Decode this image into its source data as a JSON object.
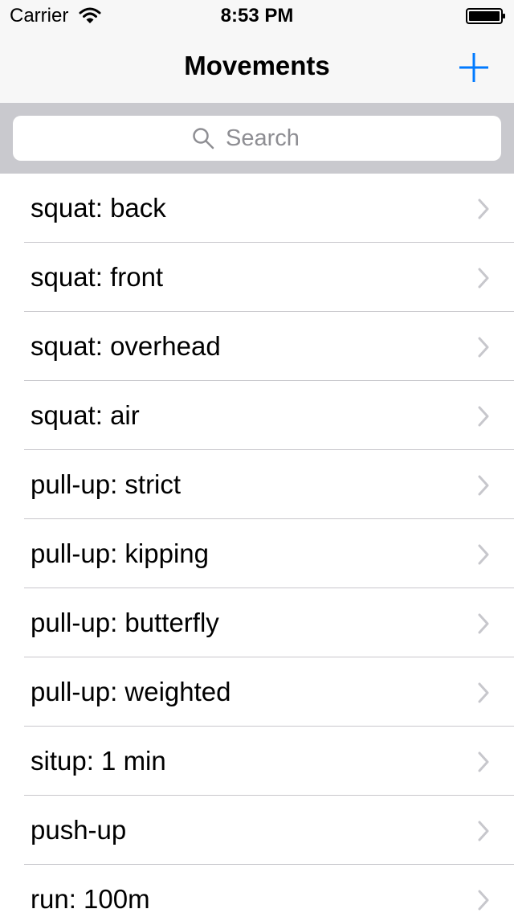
{
  "status_bar": {
    "carrier": "Carrier",
    "time": "8:53 PM"
  },
  "nav": {
    "title": "Movements",
    "add_icon": "plus-icon",
    "accent_color": "#007aff"
  },
  "search": {
    "placeholder": "Search",
    "value": ""
  },
  "movements": {
    "items": [
      {
        "label": "squat: back"
      },
      {
        "label": "squat: front"
      },
      {
        "label": "squat: overhead"
      },
      {
        "label": "squat: air"
      },
      {
        "label": "pull-up: strict"
      },
      {
        "label": "pull-up: kipping"
      },
      {
        "label": "pull-up: butterfly"
      },
      {
        "label": "pull-up: weighted"
      },
      {
        "label": "situp: 1 min"
      },
      {
        "label": "push-up"
      },
      {
        "label": "run: 100m"
      }
    ]
  }
}
